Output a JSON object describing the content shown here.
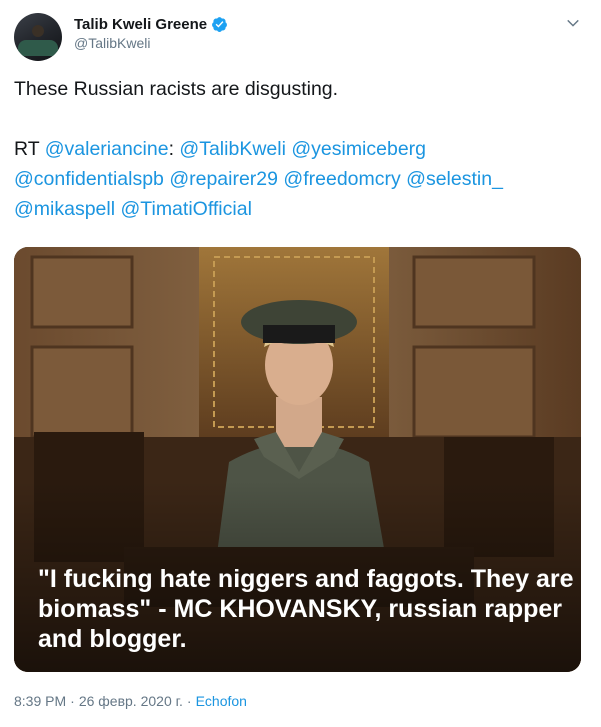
{
  "author": {
    "display_name": "Talib Kweli Greene",
    "handle": "@TalibKweli",
    "verified": true,
    "avatar_icon": "avatar-photo"
  },
  "tweet": {
    "line1": "These Russian racists are disgusting.",
    "rt_prefix": "RT ",
    "retweeted_user": "@valeriancine",
    "rt_separator": ": ",
    "mentions": [
      "@TalibKweli",
      "@yesimiceberg",
      "@confidentialspb",
      "@repairer29",
      "@freedomcry",
      "@selestin_",
      "@mikaspell",
      "@TimatiOfficial"
    ]
  },
  "media": {
    "caption": "\"I fucking hate niggers and faggots. They are biomass\" - MC KHOVANSKY, russian rapper and blogger."
  },
  "footer": {
    "time": "8:39 PM",
    "date": "26 февр. 2020 г.",
    "separator": "·",
    "source": "Echofon"
  },
  "icons": {
    "verified": "verified-badge-icon",
    "menu": "chevron-down-icon"
  },
  "colors": {
    "link": "#1b95e0",
    "verified": "#1da1f2",
    "secondary_text": "#657786"
  }
}
